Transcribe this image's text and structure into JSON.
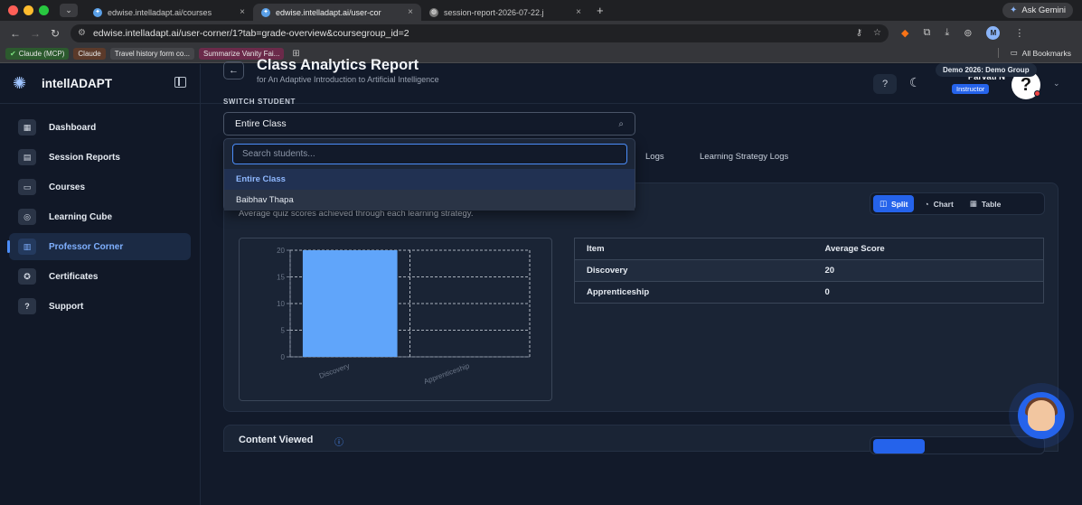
{
  "browser": {
    "tabs": [
      {
        "title": "edwise.intelladapt.ai/courses"
      },
      {
        "title": "edwise.intelladapt.ai/user-cor"
      },
      {
        "title": "session-report-2026-07-22.j"
      }
    ],
    "url": "edwise.intelladapt.ai/user-corner/1?tab=grade-overview&coursegroup_id=2",
    "gemini_label": "Ask Gemini",
    "profile_initial": "M",
    "bookmarks": [
      "Claude (MCP)",
      "Claude",
      "Travel history form co...",
      "Summarize Vanity Fai..."
    ],
    "all_bookmarks_label": "All Bookmarks"
  },
  "app": {
    "brand": "intellADAPT",
    "nav": [
      {
        "label": "Dashboard",
        "icon": "dashboard-icon"
      },
      {
        "label": "Session Reports",
        "icon": "session-reports-icon"
      },
      {
        "label": "Courses",
        "icon": "courses-icon"
      },
      {
        "label": "Learning Cube",
        "icon": "learning-cube-icon"
      },
      {
        "label": "Professor Corner",
        "icon": "professor-corner-icon"
      },
      {
        "label": "Certificates",
        "icon": "certificates-icon"
      },
      {
        "label": "Support",
        "icon": "support-icon"
      }
    ],
    "user": {
      "name": "Parvati N",
      "role": "Instructor",
      "avatar_glyph": "?"
    }
  },
  "page": {
    "title": "Class Analytics Report",
    "subtitle": "for An Adaptive Introduction to Artificial Intelligence",
    "group_badge": "Demo 2026: Demo Group",
    "switch_label": "SWITCH STUDENT",
    "selected_student": "Entire Class",
    "tabs": [
      "Logs",
      "Learning Strategy Logs"
    ],
    "card_subtitle": "Average quiz scores achieved through each learning strategy.",
    "view_toggle": [
      "Split",
      "Chart",
      "Table"
    ],
    "table": {
      "headers": [
        "Item",
        "Average Score"
      ],
      "rows": [
        [
          "Discovery",
          "20"
        ],
        [
          "Apprenticeship",
          "0"
        ]
      ]
    },
    "next_card_title": "Content Viewed"
  },
  "dropdown": {
    "placeholder": "Search students...",
    "items": [
      "Entire Class",
      "Baibhav Thapa"
    ]
  },
  "chart_data": {
    "type": "bar",
    "categories": [
      "Discovery",
      "Apprenticeship"
    ],
    "values": [
      20,
      0
    ],
    "title": "",
    "xlabel": "",
    "ylabel": "",
    "ylim": [
      0,
      20
    ],
    "yticks": [
      0,
      5,
      10,
      15,
      20
    ],
    "grid": true,
    "bar_color": "#60a5fa"
  },
  "colors": {
    "accent": "#2563eb",
    "bar": "#60a5fa",
    "background": "#121a2a"
  }
}
